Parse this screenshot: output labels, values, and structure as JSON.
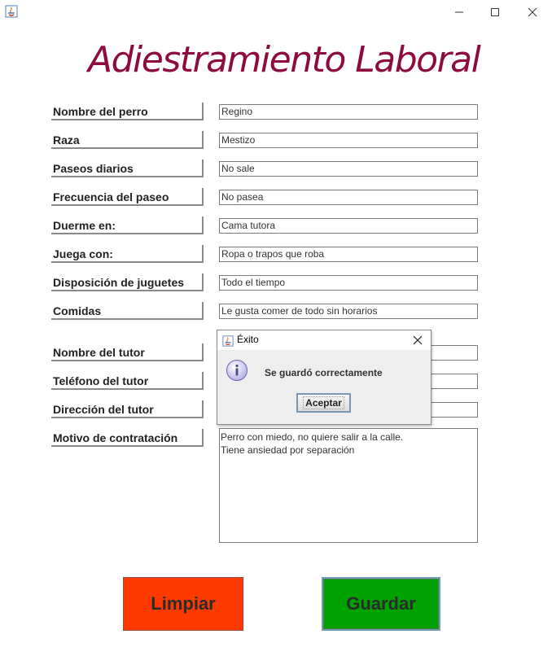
{
  "window": {
    "icons": {
      "app": "java-icon",
      "minimize": "minimize-icon",
      "maximize": "maximize-icon",
      "close": "close-icon"
    }
  },
  "heading": "Adiestramiento Laboral",
  "fields": [
    {
      "label": "Nombre del perro",
      "value": "Regino"
    },
    {
      "label": "Raza",
      "value": "Mestizo"
    },
    {
      "label": "Paseos diarios",
      "value": "No sale"
    },
    {
      "label": "Frecuencia del paseo",
      "value": "No pasea"
    },
    {
      "label": "Duerme en:",
      "value": "Cama tutora"
    },
    {
      "label": "Juega con:",
      "value": "Ropa o trapos que roba"
    },
    {
      "label": "Disposición de juguetes",
      "value": "Todo el tiempo"
    },
    {
      "label": "Comidas",
      "value": "Le gusta comer de todo sin horarios"
    },
    {
      "label": "Nombre del tutor",
      "value": ""
    },
    {
      "label": "Teléfono del tutor",
      "value": ""
    },
    {
      "label": "Dirección del tutor",
      "value": ""
    }
  ],
  "motivo": {
    "label": "Motivo de contratación",
    "lines": [
      "Perro con miedo, no quiere salir a la calle.",
      "Tiene ansiedad por separación"
    ]
  },
  "buttons": {
    "clear": "Limpiar",
    "save": "Guardar"
  },
  "dialog": {
    "title": "Éxito",
    "message": "Se guardó correctamente",
    "ok": "Aceptar"
  },
  "colors": {
    "heading": "#8e0b3f",
    "clear_button": "#ff3a00",
    "save_button": "#00a200"
  }
}
